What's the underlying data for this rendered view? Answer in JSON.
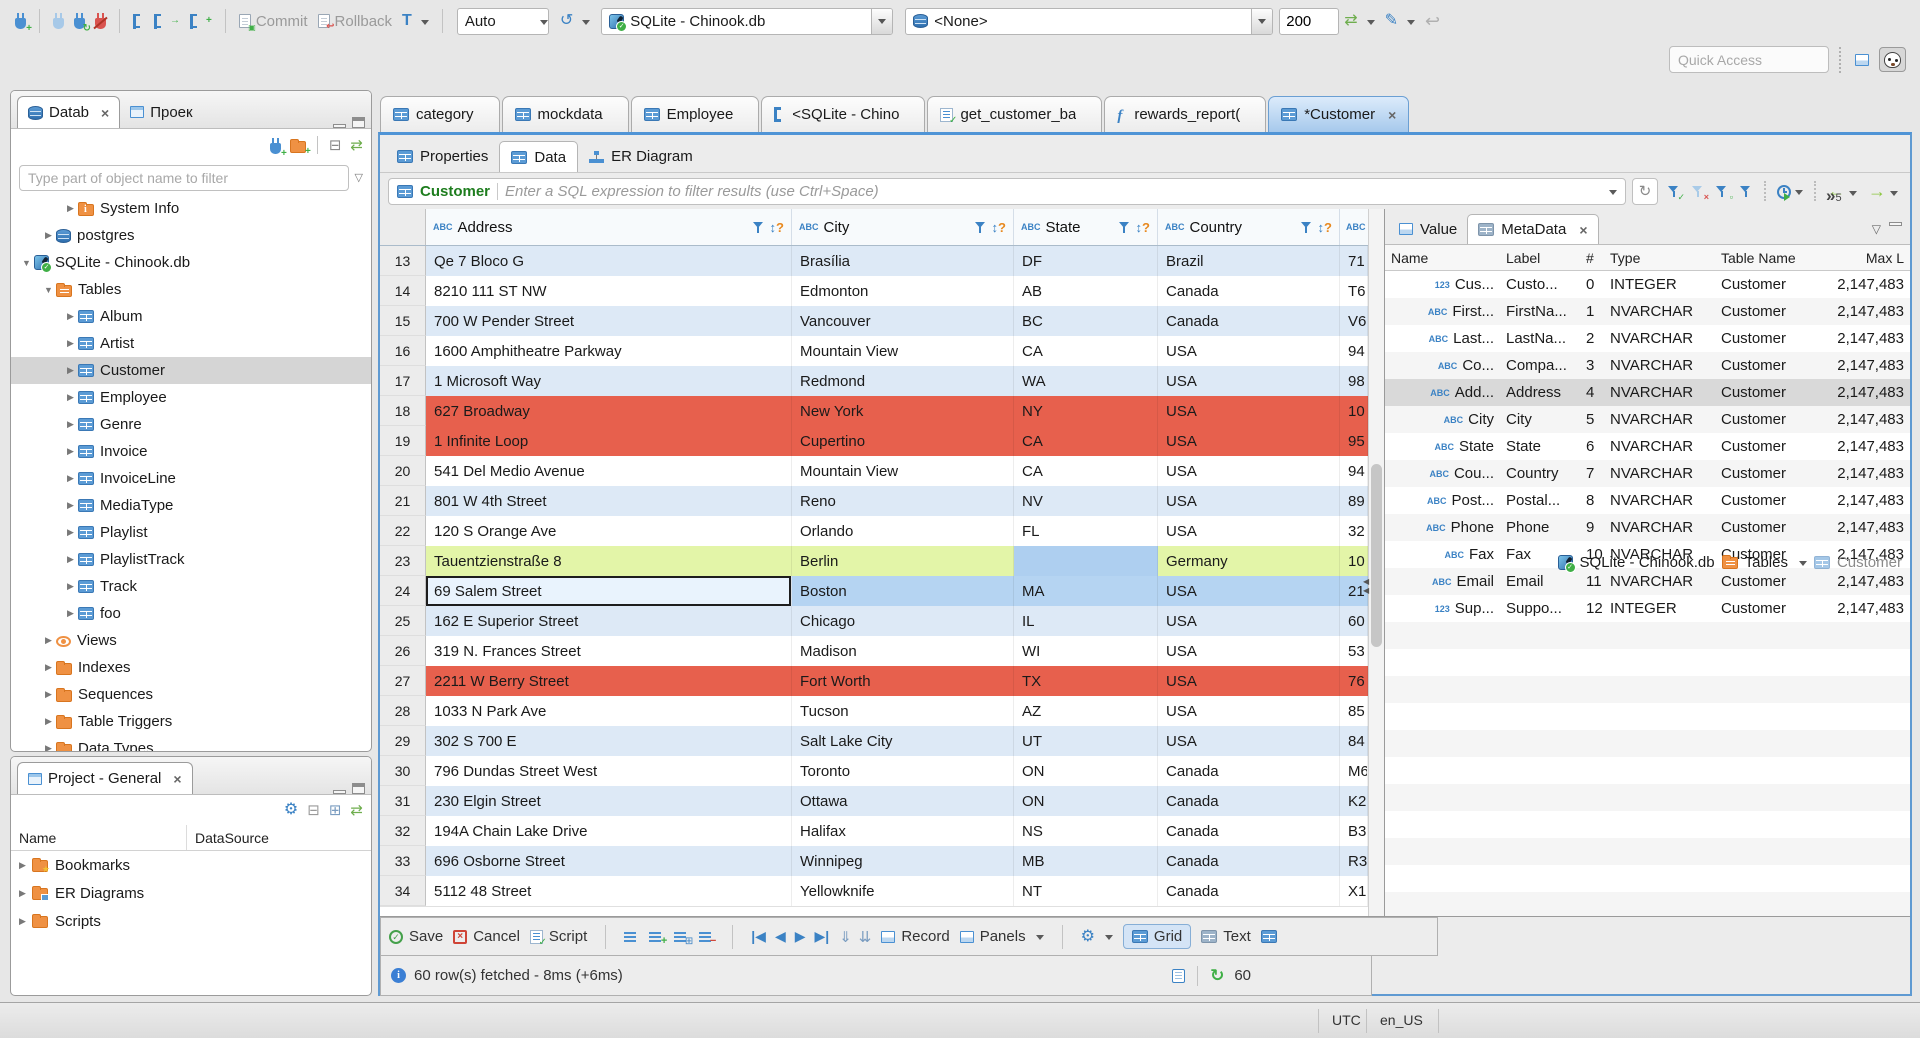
{
  "icons": {
    "close": "×",
    "menu_down": "▽",
    "sort": "↕",
    "sort_q": "?",
    "refresh": "↻",
    "history": "↺",
    "sync": "⇄",
    "undo": "↩",
    "pen": "✎",
    "gear": "⚙",
    "check": "✓",
    "cross": "×",
    "nav_first": "|◀",
    "nav_prev": "◀",
    "nav_next": "▶",
    "nav_last": "▶|",
    "fetch_page": "⇓",
    "fetch_all": "⇊",
    "back": "←",
    "forward": "→",
    "overflow": "»",
    "link": "⇄",
    "collapse_all": "⊟",
    "plus_box": "⊞",
    "minus_box": "⊟",
    "tx_letter": "T"
  },
  "toolbar": {
    "commit": "Commit",
    "rollback": "Rollback",
    "auto": "Auto",
    "connection": "SQLite - Chinook.db",
    "schema": "<None>",
    "fetch_size": "200",
    "quick_access_placeholder": "Quick Access"
  },
  "sidebar": {
    "tabs": [
      {
        "label": "Datab",
        "close": "×"
      },
      {
        "label": "Проек"
      }
    ],
    "filter_placeholder": "Type part of object name to filter",
    "tree": [
      {
        "a": "▶",
        "icon": "ic-folder-info",
        "label": "System Info",
        "lvl": "lvl2"
      },
      {
        "a": "▶",
        "icon": "ic-db",
        "label": "postgres",
        "lvl": "lvl1"
      },
      {
        "a": "▼",
        "icon": "ic-sqlite",
        "label": "SQLite - Chinook.db",
        "lvl": "lvl0"
      },
      {
        "a": "▼",
        "icon": "ic-folder-table",
        "label": "Tables",
        "lvl": "lvl1"
      },
      {
        "a": "▶",
        "icon": "ic-table",
        "label": "Album",
        "lvl": "lvl2"
      },
      {
        "a": "▶",
        "icon": "ic-table",
        "label": "Artist",
        "lvl": "lvl2"
      },
      {
        "a": "▶",
        "icon": "ic-table",
        "label": "Customer",
        "lvl": "lvl2",
        "cls": "selected"
      },
      {
        "a": "▶",
        "icon": "ic-table",
        "label": "Employee",
        "lvl": "lvl2"
      },
      {
        "a": "▶",
        "icon": "ic-table",
        "label": "Genre",
        "lvl": "lvl2"
      },
      {
        "a": "▶",
        "icon": "ic-table",
        "label": "Invoice",
        "lvl": "lvl2"
      },
      {
        "a": "▶",
        "icon": "ic-table",
        "label": "InvoiceLine",
        "lvl": "lvl2"
      },
      {
        "a": "▶",
        "icon": "ic-table",
        "label": "MediaType",
        "lvl": "lvl2"
      },
      {
        "a": "▶",
        "icon": "ic-table",
        "label": "Playlist",
        "lvl": "lvl2"
      },
      {
        "a": "▶",
        "icon": "ic-table",
        "label": "PlaylistTrack",
        "lvl": "lvl2"
      },
      {
        "a": "▶",
        "icon": "ic-table",
        "label": "Track",
        "lvl": "lvl2"
      },
      {
        "a": "▶",
        "icon": "ic-table",
        "label": "foo",
        "lvl": "lvl2"
      },
      {
        "a": "▶",
        "icon": "ic-views",
        "label": "Views",
        "lvl": "lvl1"
      },
      {
        "a": "▶",
        "icon": "ic-folder",
        "label": "Indexes",
        "lvl": "lvl1"
      },
      {
        "a": "▶",
        "icon": "ic-folder",
        "label": "Sequences",
        "lvl": "lvl1"
      },
      {
        "a": "▶",
        "icon": "ic-folder",
        "label": "Table Triggers",
        "lvl": "lvl1"
      },
      {
        "a": "▶",
        "icon": "ic-folder",
        "label": "Data Types",
        "lvl": "lvl1"
      }
    ]
  },
  "project_panel": {
    "title": "Project - General",
    "close": "×",
    "columns": [
      "Name",
      "DataSource"
    ],
    "items": [
      {
        "a": "▶",
        "icon": "ic-folder-star",
        "label": "Bookmarks"
      },
      {
        "a": "▶",
        "icon": "ic-folder-erd",
        "label": "ER Diagrams"
      },
      {
        "a": "▶",
        "icon": "ic-folder",
        "label": "Scripts"
      }
    ]
  },
  "editor": {
    "tabs": [
      {
        "label": "category",
        "icon": "ic-table"
      },
      {
        "label": "mockdata",
        "icon": "ic-table"
      },
      {
        "label": "Employee",
        "icon": "ic-table"
      },
      {
        "label": "<SQLite - Chino",
        "icon": "ic-sql"
      },
      {
        "label": "get_customer_ba",
        "icon": "ic-script"
      },
      {
        "label": "rewards_report(",
        "icon": "ic-func"
      },
      {
        "label": "*Customer",
        "icon": "ic-table",
        "cls": "active",
        "close": "×"
      }
    ],
    "overflow_count": "5",
    "subtabs": [
      {
        "label": "Properties",
        "icon": "ic-table"
      },
      {
        "label": "Data",
        "icon": "ic-data",
        "cls": "active"
      },
      {
        "label": "ER Diagram",
        "icon": "ic-erd"
      }
    ],
    "breadcrumb": {
      "connection": "SQLite - Chinook.db",
      "container": "Tables",
      "entity": "Customer"
    }
  },
  "filter": {
    "entity": "Customer",
    "placeholder": "Enter a SQL expression to filter results (use Ctrl+Space)"
  },
  "grid": {
    "partial_prefix": "ABC",
    "columns": [
      {
        "k": "h0",
        "prefix": "ABC",
        "label": "Address"
      },
      {
        "k": "h1",
        "prefix": "ABC",
        "label": "City"
      },
      {
        "k": "h2",
        "prefix": "ABC",
        "label": "State"
      },
      {
        "k": "h3",
        "prefix": "ABC",
        "label": "Country"
      }
    ],
    "rows": [
      {
        "n": "13",
        "cls": "alt",
        "cells": [
          {
            "t": "Qe 7 Bloco G"
          },
          {
            "t": "Brasília"
          },
          {
            "t": "DF"
          },
          {
            "t": "Brazil"
          },
          {
            "t": "71"
          }
        ]
      },
      {
        "n": "14",
        "cls": "",
        "cells": [
          {
            "t": "8210 111 ST NW"
          },
          {
            "t": "Edmonton"
          },
          {
            "t": "AB"
          },
          {
            "t": "Canada"
          },
          {
            "t": "T6"
          }
        ]
      },
      {
        "n": "15",
        "cls": "alt",
        "cells": [
          {
            "t": "700 W Pender Street"
          },
          {
            "t": "Vancouver"
          },
          {
            "t": "BC"
          },
          {
            "t": "Canada"
          },
          {
            "t": "V6"
          }
        ]
      },
      {
        "n": "16",
        "cls": "",
        "cells": [
          {
            "t": "1600 Amphitheatre Parkway"
          },
          {
            "t": "Mountain View"
          },
          {
            "t": "CA"
          },
          {
            "t": "USA"
          },
          {
            "t": "94"
          }
        ]
      },
      {
        "n": "17",
        "cls": "alt",
        "cells": [
          {
            "t": "1 Microsoft Way"
          },
          {
            "t": "Redmond"
          },
          {
            "t": "WA"
          },
          {
            "t": "USA"
          },
          {
            "t": "98"
          }
        ]
      },
      {
        "n": "18",
        "cls": "red",
        "cells": [
          {
            "t": "627 Broadway"
          },
          {
            "t": "New York"
          },
          {
            "t": "NY"
          },
          {
            "t": "USA"
          },
          {
            "t": "10"
          }
        ]
      },
      {
        "n": "19",
        "cls": "red",
        "cells": [
          {
            "t": "1 Infinite Loop"
          },
          {
            "t": "Cupertino"
          },
          {
            "t": "CA"
          },
          {
            "t": "USA"
          },
          {
            "t": "95"
          }
        ]
      },
      {
        "n": "20",
        "cls": "",
        "cells": [
          {
            "t": "541 Del Medio Avenue"
          },
          {
            "t": "Mountain View"
          },
          {
            "t": "CA"
          },
          {
            "t": "USA"
          },
          {
            "t": "94"
          }
        ]
      },
      {
        "n": "21",
        "cls": "alt",
        "cells": [
          {
            "t": "801 W 4th Street"
          },
          {
            "t": "Reno"
          },
          {
            "t": "NV"
          },
          {
            "t": "USA"
          },
          {
            "t": "89"
          }
        ]
      },
      {
        "n": "22",
        "cls": "",
        "cells": [
          {
            "t": "120 S Orange Ave"
          },
          {
            "t": "Orlando"
          },
          {
            "t": "FL"
          },
          {
            "t": "USA"
          },
          {
            "t": "32"
          }
        ]
      },
      {
        "n": "23",
        "cls": "green",
        "cells": [
          {
            "t": "Tauentzienstraße 8"
          },
          {
            "t": "Berlin"
          },
          {
            "t": "",
            "cls": "cellsel"
          },
          {
            "t": "Germany"
          },
          {
            "t": "10"
          }
        ]
      },
      {
        "n": "24",
        "cls": "sel",
        "cells": [
          {
            "t": "69 Salem Street",
            "cls": "focus"
          },
          {
            "t": "Boston"
          },
          {
            "t": "MA"
          },
          {
            "t": "USA"
          },
          {
            "t": "21"
          }
        ]
      },
      {
        "n": "25",
        "cls": "alt",
        "cells": [
          {
            "t": "162 E Superior Street"
          },
          {
            "t": "Chicago"
          },
          {
            "t": "IL"
          },
          {
            "t": "USA"
          },
          {
            "t": "60"
          }
        ]
      },
      {
        "n": "26",
        "cls": "",
        "cells": [
          {
            "t": "319 N. Frances Street"
          },
          {
            "t": "Madison"
          },
          {
            "t": "WI"
          },
          {
            "t": "USA"
          },
          {
            "t": "53"
          }
        ]
      },
      {
        "n": "27",
        "cls": "red",
        "cells": [
          {
            "t": "2211 W Berry Street"
          },
          {
            "t": "Fort Worth"
          },
          {
            "t": "TX"
          },
          {
            "t": "USA"
          },
          {
            "t": "76"
          }
        ]
      },
      {
        "n": "28",
        "cls": "",
        "cells": [
          {
            "t": "1033 N Park Ave"
          },
          {
            "t": "Tucson"
          },
          {
            "t": "AZ"
          },
          {
            "t": "USA"
          },
          {
            "t": "85"
          }
        ]
      },
      {
        "n": "29",
        "cls": "alt",
        "cells": [
          {
            "t": "302 S 700 E"
          },
          {
            "t": "Salt Lake City"
          },
          {
            "t": "UT"
          },
          {
            "t": "USA"
          },
          {
            "t": "84"
          }
        ]
      },
      {
        "n": "30",
        "cls": "",
        "cells": [
          {
            "t": "796 Dundas Street West"
          },
          {
            "t": "Toronto"
          },
          {
            "t": "ON"
          },
          {
            "t": "Canada"
          },
          {
            "t": "M6"
          }
        ]
      },
      {
        "n": "31",
        "cls": "alt",
        "cells": [
          {
            "t": "230 Elgin Street"
          },
          {
            "t": "Ottawa"
          },
          {
            "t": "ON"
          },
          {
            "t": "Canada"
          },
          {
            "t": "K2"
          }
        ]
      },
      {
        "n": "32",
        "cls": "",
        "cells": [
          {
            "t": "194A Chain Lake Drive"
          },
          {
            "t": "Halifax"
          },
          {
            "t": "NS"
          },
          {
            "t": "Canada"
          },
          {
            "t": "B3"
          }
        ]
      },
      {
        "n": "33",
        "cls": "alt",
        "cells": [
          {
            "t": "696 Osborne Street"
          },
          {
            "t": "Winnipeg"
          },
          {
            "t": "MB"
          },
          {
            "t": "Canada"
          },
          {
            "t": "R3"
          }
        ]
      },
      {
        "n": "34",
        "cls": "",
        "cells": [
          {
            "t": "5112 48 Street"
          },
          {
            "t": "Yellowknife"
          },
          {
            "t": "NT"
          },
          {
            "t": "Canada"
          },
          {
            "t": "X1"
          }
        ]
      }
    ]
  },
  "metadata": {
    "tabs": [
      {
        "label": "Value"
      },
      {
        "label": "MetaData",
        "close": "×"
      }
    ],
    "columns": [
      "Name",
      "Label",
      "#",
      "Type",
      "Table Name",
      "Max L"
    ],
    "rows": [
      {
        "icon": "123",
        "name": "Cus...",
        "label": "Custo...",
        "num": "0",
        "type": "INTEGER",
        "table": "Customer",
        "max": "2,147,483"
      },
      {
        "icon": "ABC",
        "name": "First...",
        "label": "FirstNa...",
        "num": "1",
        "type": "NVARCHAR",
        "table": "Customer",
        "max": "2,147,483"
      },
      {
        "icon": "ABC",
        "name": "Last...",
        "label": "LastNa...",
        "num": "2",
        "type": "NVARCHAR",
        "table": "Customer",
        "max": "2,147,483"
      },
      {
        "icon": "ABC",
        "name": "Co...",
        "label": "Compa...",
        "num": "3",
        "type": "NVARCHAR",
        "table": "Customer",
        "max": "2,147,483"
      },
      {
        "icon": "ABC",
        "name": "Add...",
        "label": "Address",
        "num": "4",
        "type": "NVARCHAR",
        "table": "Customer",
        "max": "2,147,483",
        "cls": "selected"
      },
      {
        "icon": "ABC",
        "name": "City",
        "label": "City",
        "num": "5",
        "type": "NVARCHAR",
        "table": "Customer",
        "max": "2,147,483"
      },
      {
        "icon": "ABC",
        "name": "State",
        "label": "State",
        "num": "6",
        "type": "NVARCHAR",
        "table": "Customer",
        "max": "2,147,483"
      },
      {
        "icon": "ABC",
        "name": "Cou...",
        "label": "Country",
        "num": "7",
        "type": "NVARCHAR",
        "table": "Customer",
        "max": "2,147,483"
      },
      {
        "icon": "ABC",
        "name": "Post...",
        "label": "Postal...",
        "num": "8",
        "type": "NVARCHAR",
        "table": "Customer",
        "max": "2,147,483"
      },
      {
        "icon": "ABC",
        "name": "Phone",
        "label": "Phone",
        "num": "9",
        "type": "NVARCHAR",
        "table": "Customer",
        "max": "2,147,483"
      },
      {
        "icon": "ABC",
        "name": "Fax",
        "label": "Fax",
        "num": "10",
        "type": "NVARCHAR",
        "table": "Customer",
        "max": "2,147,483"
      },
      {
        "icon": "ABC",
        "name": "Email",
        "label": "Email",
        "num": "11",
        "type": "NVARCHAR",
        "table": "Customer",
        "max": "2,147,483"
      },
      {
        "icon": "123",
        "name": "Sup...",
        "label": "Suppo...",
        "num": "12",
        "type": "INTEGER",
        "table": "Customer",
        "max": "2,147,483"
      }
    ]
  },
  "resultbar": {
    "save": "Save",
    "cancel": "Cancel",
    "script": "Script",
    "record": "Record",
    "panels": "Panels",
    "grid": "Grid",
    "text": "Text"
  },
  "status": {
    "fetch": "60 row(s) fetched - 8ms (+6ms)",
    "refresh_count": "60"
  },
  "statusbar": {
    "timezone": "UTC",
    "locale": "en_US"
  }
}
